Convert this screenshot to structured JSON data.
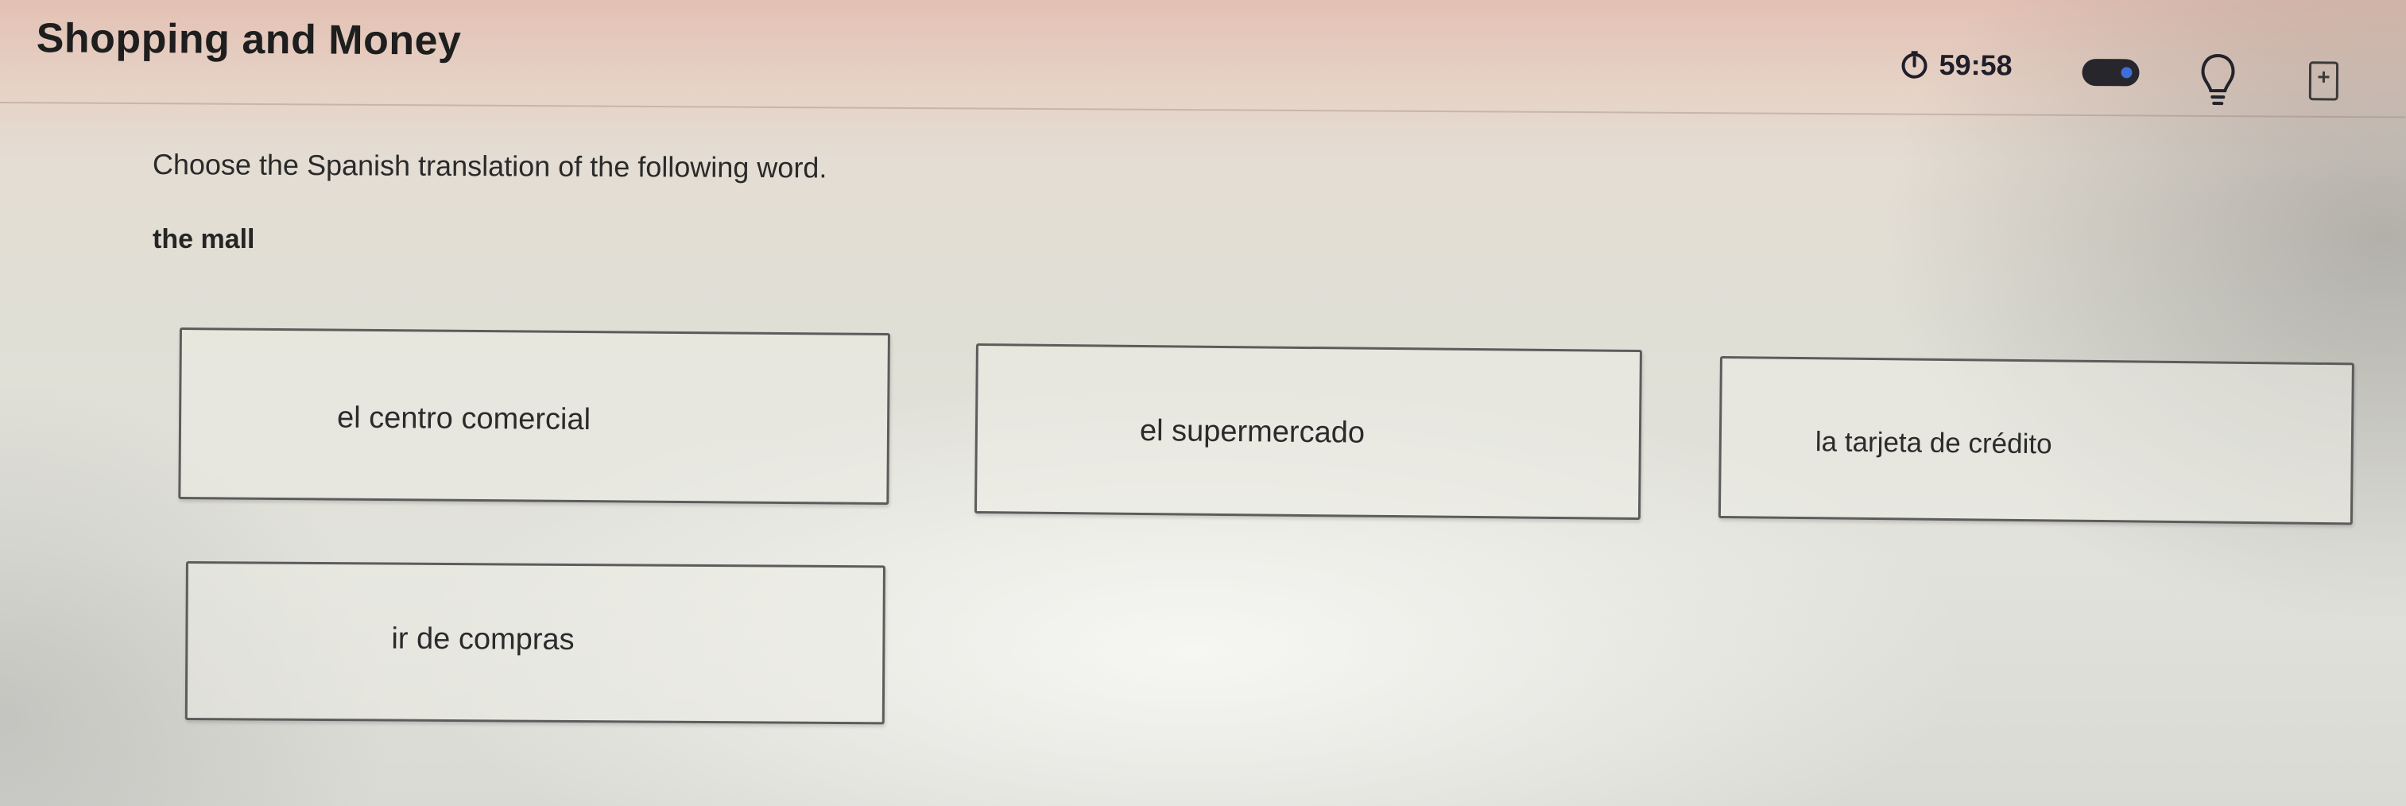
{
  "header": {
    "title": "Shopping and Money",
    "timer": "59:58",
    "icons": [
      "timer-icon",
      "toggle-switch",
      "lightbulb-icon",
      "calculator-icon"
    ]
  },
  "question": {
    "instruction": "Choose the Spanish translation of the following word.",
    "prompt_word": "the mall"
  },
  "choices": [
    {
      "label": "el centro comercial"
    },
    {
      "label": "el supermercado"
    },
    {
      "label": "la tarjeta de crédito"
    },
    {
      "label": "ir de compras"
    }
  ],
  "colors": {
    "accent": "#3e6fd8",
    "text": "#222222",
    "border": "#5c5c5c"
  }
}
